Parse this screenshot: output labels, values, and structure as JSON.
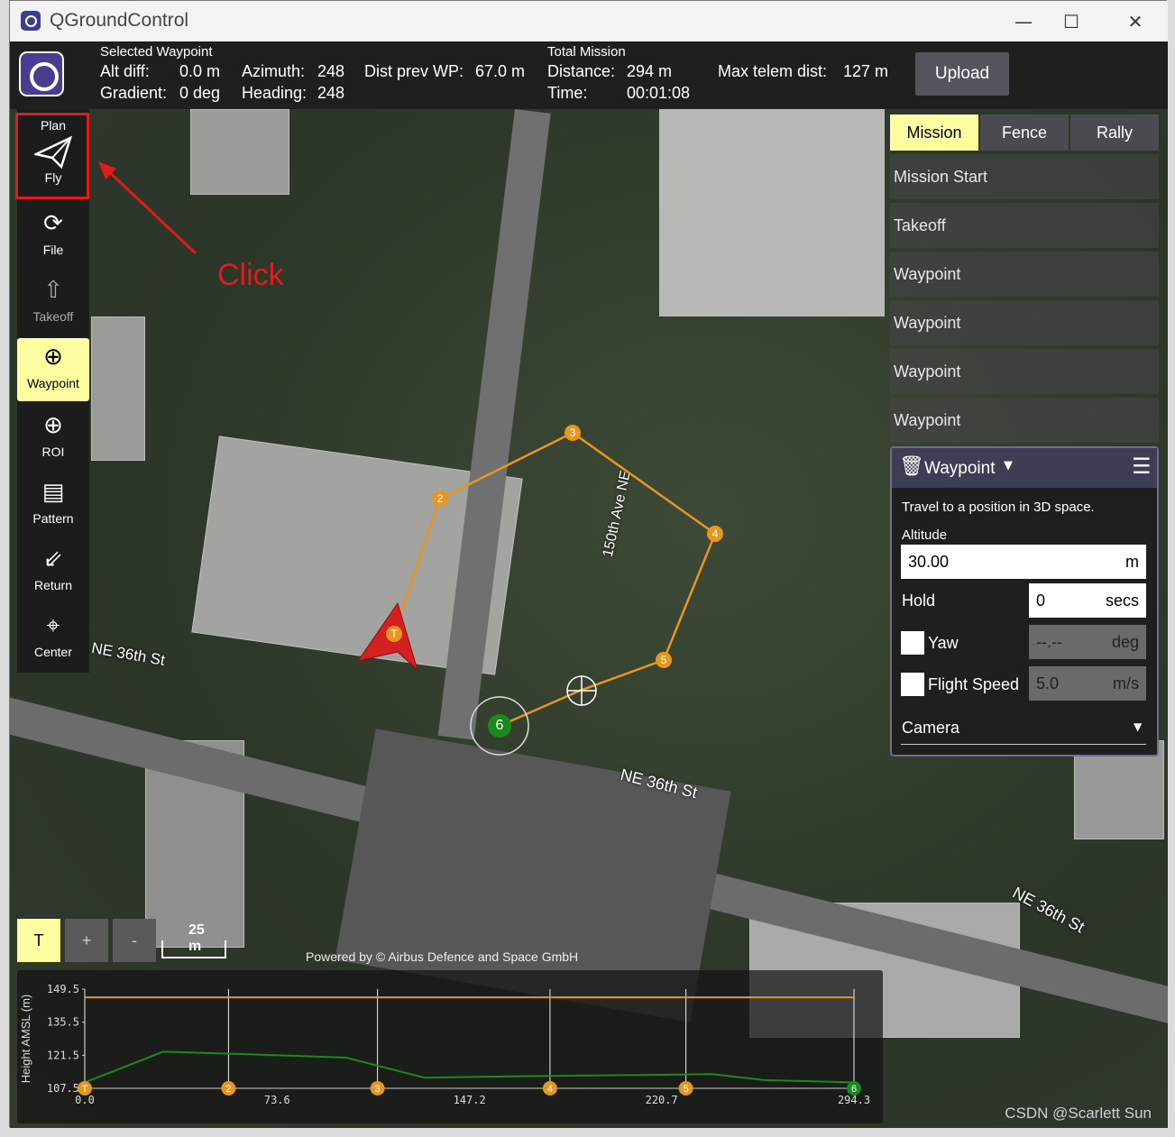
{
  "window": {
    "title": "QGroundControl",
    "minimize": "—",
    "maximize": "☐",
    "close": "✕"
  },
  "toolbar": {
    "selected_waypoint_title": "Selected Waypoint",
    "alt_diff_label": "Alt diff:",
    "alt_diff_value": "0.0 m",
    "gradient_label": "Gradient:",
    "gradient_value": "0 deg",
    "azimuth_label": "Azimuth:",
    "azimuth_value": "248",
    "heading_label": "Heading:",
    "heading_value": "248",
    "dist_prev_label": "Dist prev WP:",
    "dist_prev_value": "67.0 m",
    "total_mission_title": "Total Mission",
    "distance_label": "Distance:",
    "distance_value": "294 m",
    "time_label": "Time:",
    "time_value": "00:01:08",
    "max_telem_label": "Max telem dist:",
    "max_telem_value": "127 m",
    "upload_label": "Upload"
  },
  "left_toolbar": {
    "plan_label": "Plan",
    "fly_label": "Fly",
    "file_label": "File",
    "takeoff_label": "Takeoff",
    "waypoint_label": "Waypoint",
    "roi_label": "ROI",
    "pattern_label": "Pattern",
    "return_label": "Return",
    "center_label": "Center"
  },
  "annotation": {
    "click_text": "Click"
  },
  "right_panel": {
    "tabs": [
      "Mission",
      "Fence",
      "Rally"
    ],
    "active_tab": "Mission",
    "items": [
      "Mission Start",
      "Takeoff",
      "Waypoint",
      "Waypoint",
      "Waypoint",
      "Waypoint"
    ]
  },
  "waypoint_editor": {
    "title": "Waypoint",
    "description": "Travel to a position in 3D space.",
    "altitude_label": "Altitude",
    "altitude_value": "30.00",
    "altitude_unit": "m",
    "hold_label": "Hold",
    "hold_value": "0",
    "hold_unit": "secs",
    "yaw_label": "Yaw",
    "yaw_value": "--.--",
    "yaw_unit": "deg",
    "speed_label": "Flight Speed",
    "speed_value": "5.0",
    "speed_unit": "m/s",
    "camera_label": "Camera"
  },
  "map": {
    "street_labels": [
      "NE 36th St",
      "150th Ave NE",
      "NE 36th St",
      "NE 36th St"
    ],
    "scale_label": "25 m",
    "attribution": "Powered by © Airbus Defence and Space GmbH",
    "zoom_t": "T",
    "zoom_in": "+",
    "zoom_out": "-",
    "waypoint_labels": [
      "T",
      "2",
      "3",
      "4",
      "5",
      "6"
    ],
    "path_color": "#e8961e",
    "waypoint_color": "#e8961e",
    "active_waypoint_color": "#1a8a1a"
  },
  "chart_data": {
    "type": "line",
    "ylabel": "Height AMSL (m)",
    "y_ticks": [
      "149.5",
      "135.5",
      "121.5",
      "107.5"
    ],
    "x_ticks": [
      "0.0",
      "73.6",
      "147.2",
      "220.7",
      "294.3"
    ],
    "ylim": [
      107.5,
      149.5
    ],
    "xlim": [
      0,
      294.3
    ],
    "series": [
      {
        "color": "#e8961e",
        "x": [
          0,
          294.3
        ],
        "y": [
          146,
          146
        ]
      },
      {
        "color": "#1a8a1a",
        "x": [
          0,
          30,
          60,
          100,
          130,
          160,
          200,
          240,
          260,
          294.3
        ],
        "y": [
          110,
          123,
          122,
          120.5,
          112,
          112.5,
          113,
          113.5,
          111,
          110
        ]
      }
    ],
    "markers": [
      {
        "label": "T",
        "x": 0
      },
      {
        "label": "2",
        "x": 55
      },
      {
        "label": "3",
        "x": 112
      },
      {
        "label": "4",
        "x": 178
      },
      {
        "label": "5",
        "x": 230
      },
      {
        "label": "6",
        "x": 294.3
      }
    ],
    "grid": true
  },
  "watermark": "CSDN @Scarlett Sun"
}
